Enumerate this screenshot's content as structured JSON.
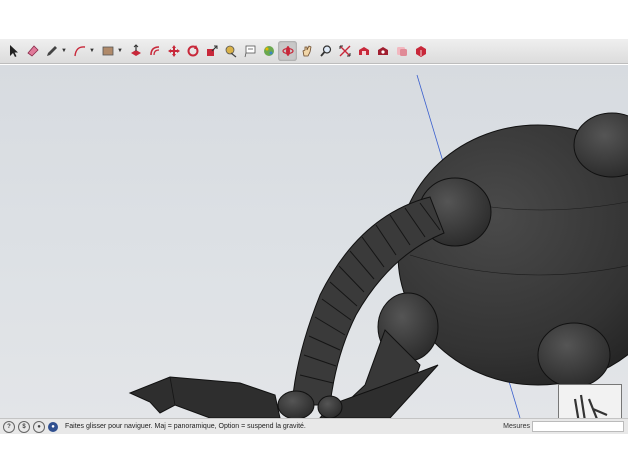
{
  "toolbar": {
    "tools": [
      {
        "name": "select-icon"
      },
      {
        "name": "eraser-icon"
      },
      {
        "name": "pencil-icon"
      },
      {
        "name": "arc-icon"
      },
      {
        "name": "rectangle-icon"
      },
      {
        "name": "push-pull-icon"
      },
      {
        "name": "offset-icon"
      },
      {
        "name": "move-icon"
      },
      {
        "name": "rotate-icon"
      },
      {
        "name": "scale-icon"
      },
      {
        "name": "tape-measure-icon"
      },
      {
        "name": "text-icon"
      },
      {
        "name": "paint-bucket-icon"
      },
      {
        "name": "orbit-icon"
      },
      {
        "name": "pan-icon"
      },
      {
        "name": "zoom-icon"
      },
      {
        "name": "zoom-extents-icon"
      },
      {
        "name": "warehouse-icon"
      },
      {
        "name": "extension-warehouse-icon"
      },
      {
        "name": "layout-icon"
      },
      {
        "name": "extension-manager-icon"
      }
    ],
    "active_tool": "orbit-icon"
  },
  "statusbar": {
    "hint": "Faites glisser pour naviguer. Maj = panoramique, Option = suspend la gravité.",
    "measures_label": "Mesures"
  },
  "colors": {
    "model_dark": "#3a3a3a",
    "sky": "#d7dbe0",
    "axis_blue": "#3a5fcd",
    "tool_red": "#c8283a"
  }
}
